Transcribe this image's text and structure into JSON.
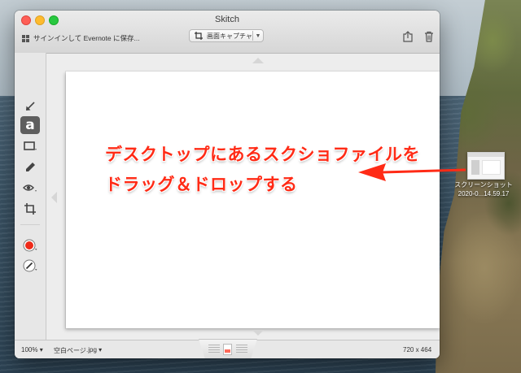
{
  "window": {
    "title": "Skitch"
  },
  "header": {
    "signin_label": "サインインして Evernote に保存...",
    "capture_label": "画面キャプチャ",
    "capture_icon": "crop-icon",
    "share_icon": "share-icon",
    "trash_icon": "trash-icon"
  },
  "toolbar": {
    "tools": [
      "arrow-tool-icon",
      "text-tool-icon",
      "rectangle-tool-icon",
      "marker-tool-icon",
      "pixelate-tool-icon",
      "crop-tool-icon",
      "color-picker-icon",
      "line-width-icon"
    ],
    "text_tool_glyph": "a",
    "active_color": "#ee2b1a"
  },
  "canvas": {
    "annotation_line1": "デスクトップにあるスクショファイルを",
    "annotation_line2": "ドラッグ＆ドロップする",
    "annotation_color": "#ff2b16"
  },
  "status": {
    "zoom": "100%",
    "zoom_chevron": "▾",
    "page_label": "空白ページ",
    "format_label": ".jpg",
    "format_chevron": "▾",
    "dimensions": "720 x 464"
  },
  "desktop": {
    "file_name_line1": "スクリーンショット",
    "file_name_line2": "2020-0...14.59.17"
  }
}
